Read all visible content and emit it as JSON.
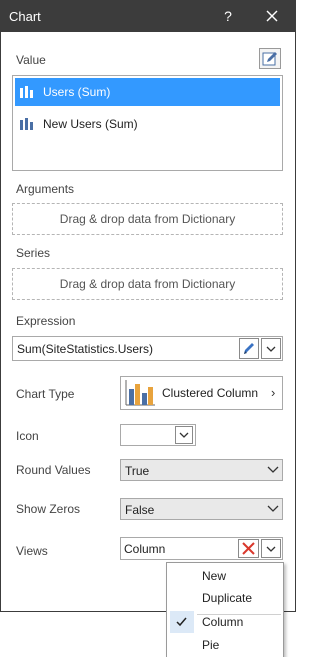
{
  "window": {
    "title": "Chart",
    "help_label": "?"
  },
  "value": {
    "label": "Value",
    "items": [
      {
        "label": "Users (Sum)",
        "selected": true
      },
      {
        "label": "New Users (Sum)",
        "selected": false
      }
    ]
  },
  "arguments": {
    "label": "Arguments",
    "drop_text": "Drag & drop data from Dictionary"
  },
  "series": {
    "label": "Series",
    "drop_text": "Drag & drop data from Dictionary"
  },
  "expression": {
    "label": "Expression",
    "value": "Sum(SiteStatistics.Users)"
  },
  "chart_type": {
    "label": "Chart Type",
    "value": "Clustered Column"
  },
  "icon": {
    "label": "Icon"
  },
  "round_values": {
    "label": "Round Values",
    "value": "True"
  },
  "show_zeros": {
    "label": "Show Zeros",
    "value": "False"
  },
  "views": {
    "label": "Views",
    "value": "Column"
  },
  "context_menu": {
    "items": [
      {
        "label": "New",
        "checked": false
      },
      {
        "label": "Duplicate",
        "checked": false
      },
      {
        "label": "Column",
        "checked": true
      },
      {
        "label": "Pie",
        "checked": false
      }
    ]
  },
  "colors": {
    "title_bar": "#3c3c3c",
    "selection": "#3399ff",
    "chart_icon_blue": "#4a6fa5",
    "chart_icon_orange": "#e8a33d",
    "delete_red": "#d9382c"
  }
}
